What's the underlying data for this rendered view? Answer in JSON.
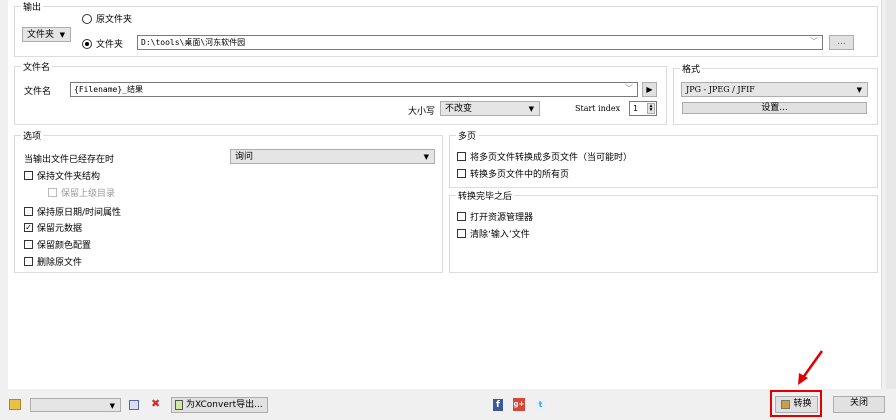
{
  "output": {
    "title": "输出",
    "mode_select": "文件夹",
    "radio_original": "原文件夹",
    "radio_folder": "文件夹",
    "folder_path": "D:\\tools\\桌面\\河东软件园",
    "browse_label": "..."
  },
  "filename": {
    "title": "文件名",
    "label": "文件名",
    "value": "{Filename}_结果",
    "case_label": "大小写",
    "case_value": "不改变",
    "start_index_label": "Start index",
    "start_index_value": "1"
  },
  "format": {
    "title": "格式",
    "value": "JPG - JPEG / JFIF",
    "settings_label": "设置..."
  },
  "options": {
    "title": "选项",
    "exists_label": "当输出文件已经存在时",
    "exists_value": "询问",
    "items": [
      {
        "label": "保持文件夹结构",
        "checked": false
      },
      {
        "label": "保留上级目录",
        "checked": false,
        "disabled": true
      },
      {
        "label": "保持原日期/时间属性",
        "checked": false
      },
      {
        "label": "保留元数据",
        "checked": true
      },
      {
        "label": "保留颜色配置",
        "checked": false
      },
      {
        "label": "删除原文件",
        "checked": false
      }
    ]
  },
  "multipage": {
    "title": "多页",
    "items": [
      {
        "label": "将多页文件转换成多页文件（当可能时）",
        "checked": false
      },
      {
        "label": "转换多页文件中的所有页",
        "checked": false
      }
    ]
  },
  "after": {
    "title": "转换完毕之后",
    "items": [
      {
        "label": "打开资源管理器",
        "checked": false
      },
      {
        "label": "清除‘输入’文件",
        "checked": false
      }
    ]
  },
  "bottom": {
    "export_label": "为XConvert导出...",
    "convert_label": "转换",
    "close_label": "关闭",
    "facebook": "f",
    "gplus": "g+",
    "twitter": "t"
  },
  "colors": {
    "highlight": "#e00000"
  }
}
